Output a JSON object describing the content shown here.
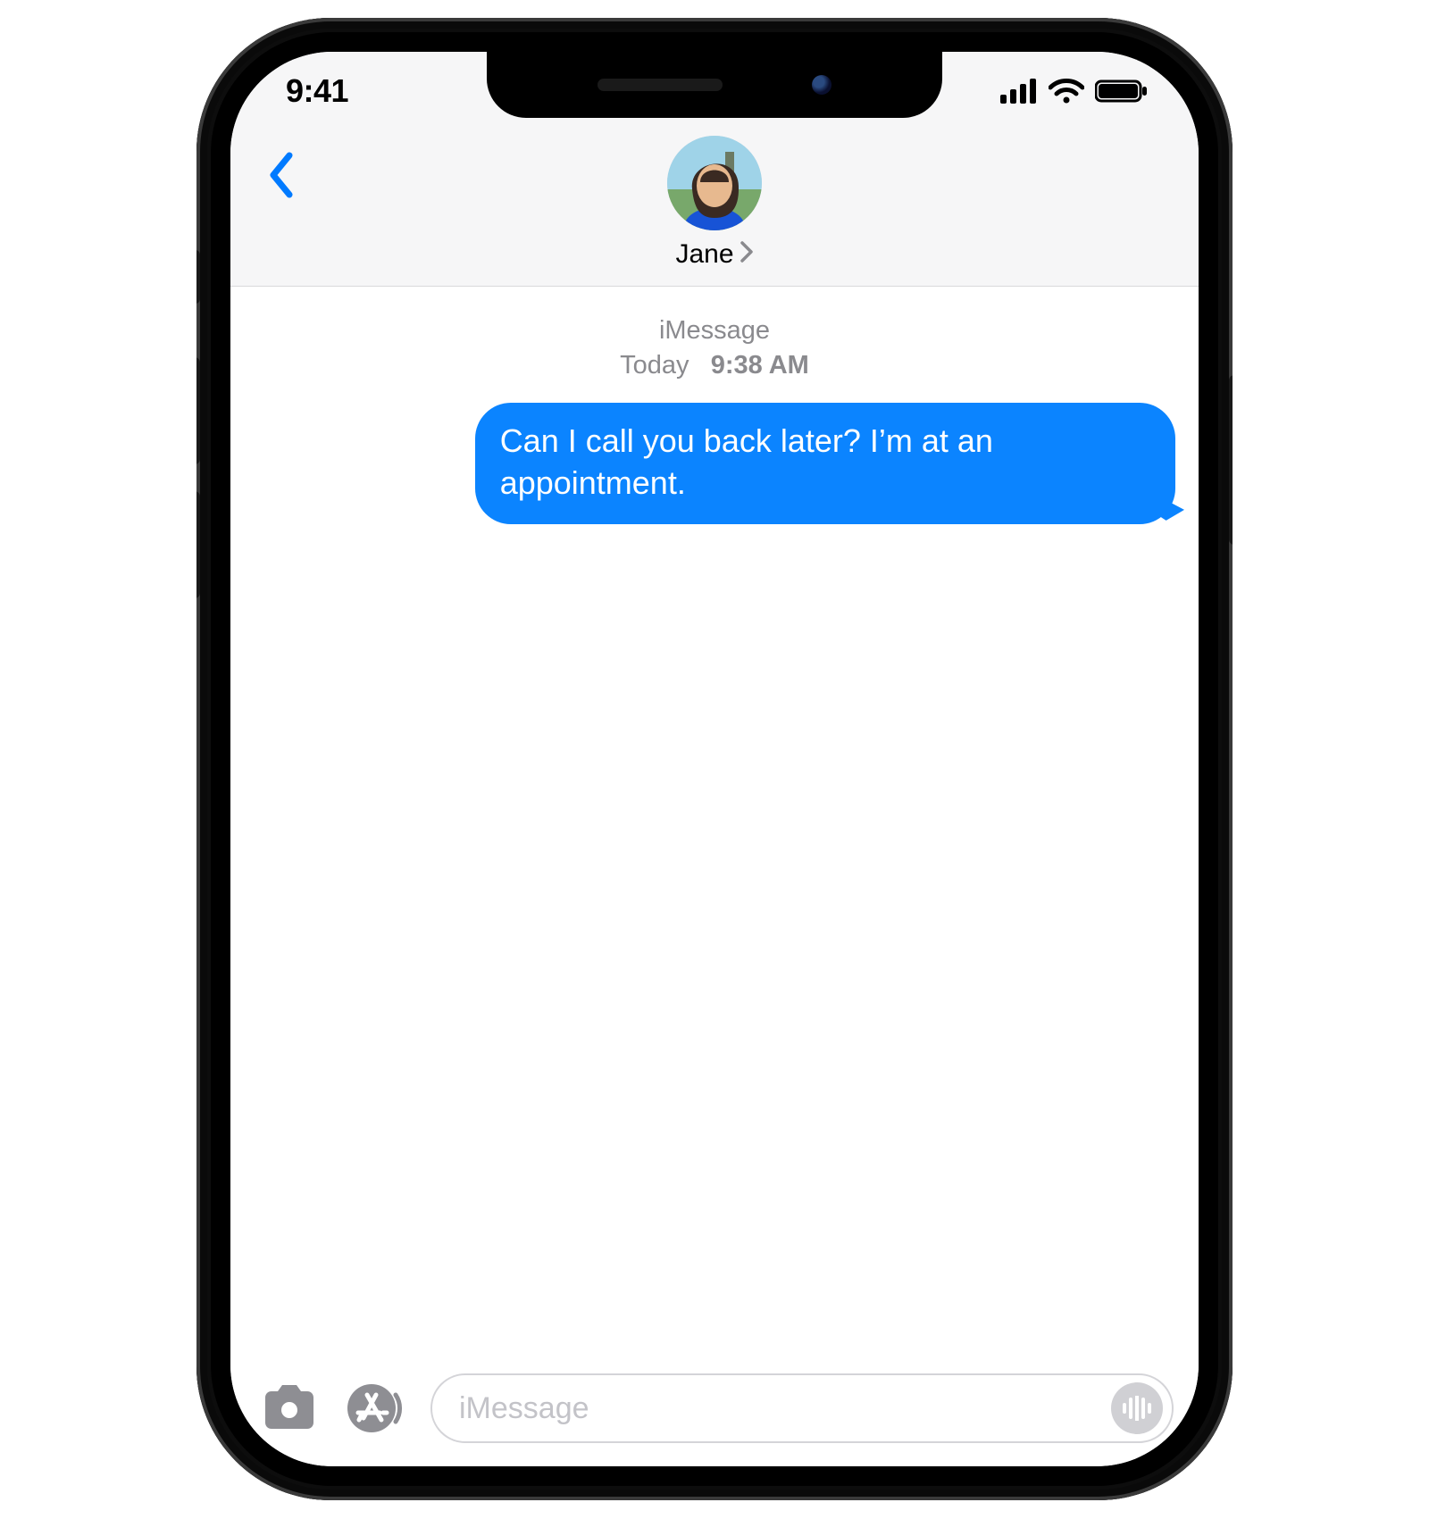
{
  "status": {
    "time": "9:41"
  },
  "header": {
    "contact_name": "Jane"
  },
  "thread": {
    "channel_label": "iMessage",
    "timestamp_prefix": "Today",
    "timestamp_time": "9:38 AM",
    "messages": [
      {
        "direction": "out",
        "text": "Can I call you back later? I’m at an appointment."
      }
    ]
  },
  "compose": {
    "placeholder": "iMessage"
  }
}
